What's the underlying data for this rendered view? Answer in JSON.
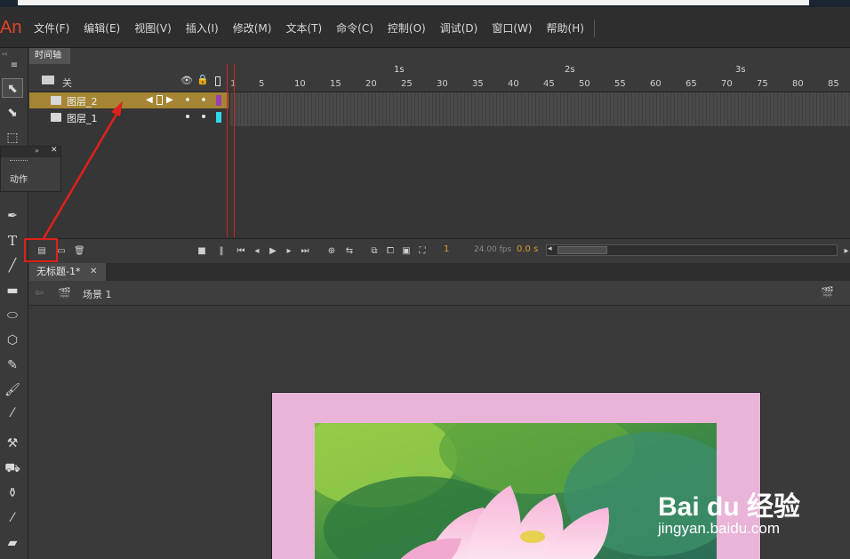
{
  "app": {
    "logo": "An"
  },
  "menu": [
    "文件(F)",
    "编辑(E)",
    "视图(V)",
    "插入(I)",
    "修改(M)",
    "文本(T)",
    "命令(C)",
    "控制(O)",
    "调试(D)",
    "窗口(W)",
    "帮助(H)"
  ],
  "timeline": {
    "tab": "时间轴",
    "header_label": "关",
    "seconds": [
      "1s",
      "2s",
      "3s"
    ],
    "frame_numbers": [
      "1",
      "5",
      "10",
      "15",
      "20",
      "25",
      "30",
      "35",
      "40",
      "45",
      "50",
      "55",
      "60",
      "65",
      "70",
      "75",
      "80",
      "85"
    ],
    "layers": [
      {
        "name": "图层_2",
        "selected": true,
        "color": "#9b3fb0"
      },
      {
        "name": "图层_1",
        "selected": false,
        "color": "#2fd8e8"
      }
    ],
    "current_frame": "1",
    "fps": "24.00 fps",
    "time": "0.0 s"
  },
  "actions_panel": {
    "label": "动作"
  },
  "document": {
    "tab": "无标题-1*",
    "scene": "场景 1"
  },
  "watermark": {
    "brand": "Bai du 经验",
    "url": "jingyan.baidu.com"
  },
  "colors": {
    "accent": "#e0201c",
    "selected_layer": "#a58533",
    "stage_bg": "#e9b4d8"
  }
}
